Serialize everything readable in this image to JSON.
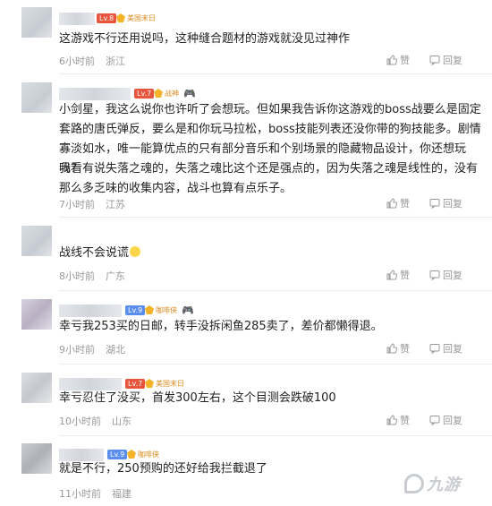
{
  "colors": {
    "lv_blue": "#5a8dee",
    "lv_red": "#e8553d",
    "badge_gold": "#f5b32a",
    "meta_gray": "#999999"
  },
  "actions": {
    "like_label": "赞",
    "reply_label": "回复",
    "like_icon": "thumb-up-icon",
    "reply_icon": "comment-bubble-icon"
  },
  "comments": [
    {
      "level": "Lv.8",
      "badge": "美国末日",
      "text": "这游戏不行还用说吗，这种缝合题材的游戏就没见过神作",
      "time": "6小时前",
      "location": "浙江"
    },
    {
      "level": "Lv.7",
      "badge": "战神",
      "text1": "小剑星，我这么说你也许听了会想玩。但如果我告诉你这游戏的boss战要么是固定套路的唐氏弹反，要么是和你玩马拉松，boss技能列表还没你带的狗技能多。剧情寡淡如水，唯一能算优点的只有部分音乐和个别场景的隐藏物品设计，你还想玩吗？",
      "text2": "我看有说失落之魂的，失落之魂比这个还是强点的，因为失落之魂是线性的，没有那么多乏味的收集内容，战斗也算有点乐子。",
      "time": "7小时前",
      "location": "江苏"
    },
    {
      "text": "战线不会说谎",
      "time": "8小时前",
      "location": "广东"
    },
    {
      "level": "Lv.9",
      "badge": "咖啡侠",
      "text": "幸亏我253买的日邮，转手没拆闲鱼285卖了，差价都懒得退。",
      "time": "9小时前",
      "location": "湖北"
    },
    {
      "level": "Lv.7",
      "badge": "美国末日",
      "text": "幸亏忍住了没买，首发300左右，这个目测会跌破100",
      "time": "10小时前",
      "location": "山东"
    },
    {
      "level": "Lv.9",
      "badge": "咖啡侠",
      "text": "就是不行，250预购的还好给我拦截退了",
      "time": "11小时前",
      "location": "福建"
    }
  ],
  "watermark": "九游"
}
